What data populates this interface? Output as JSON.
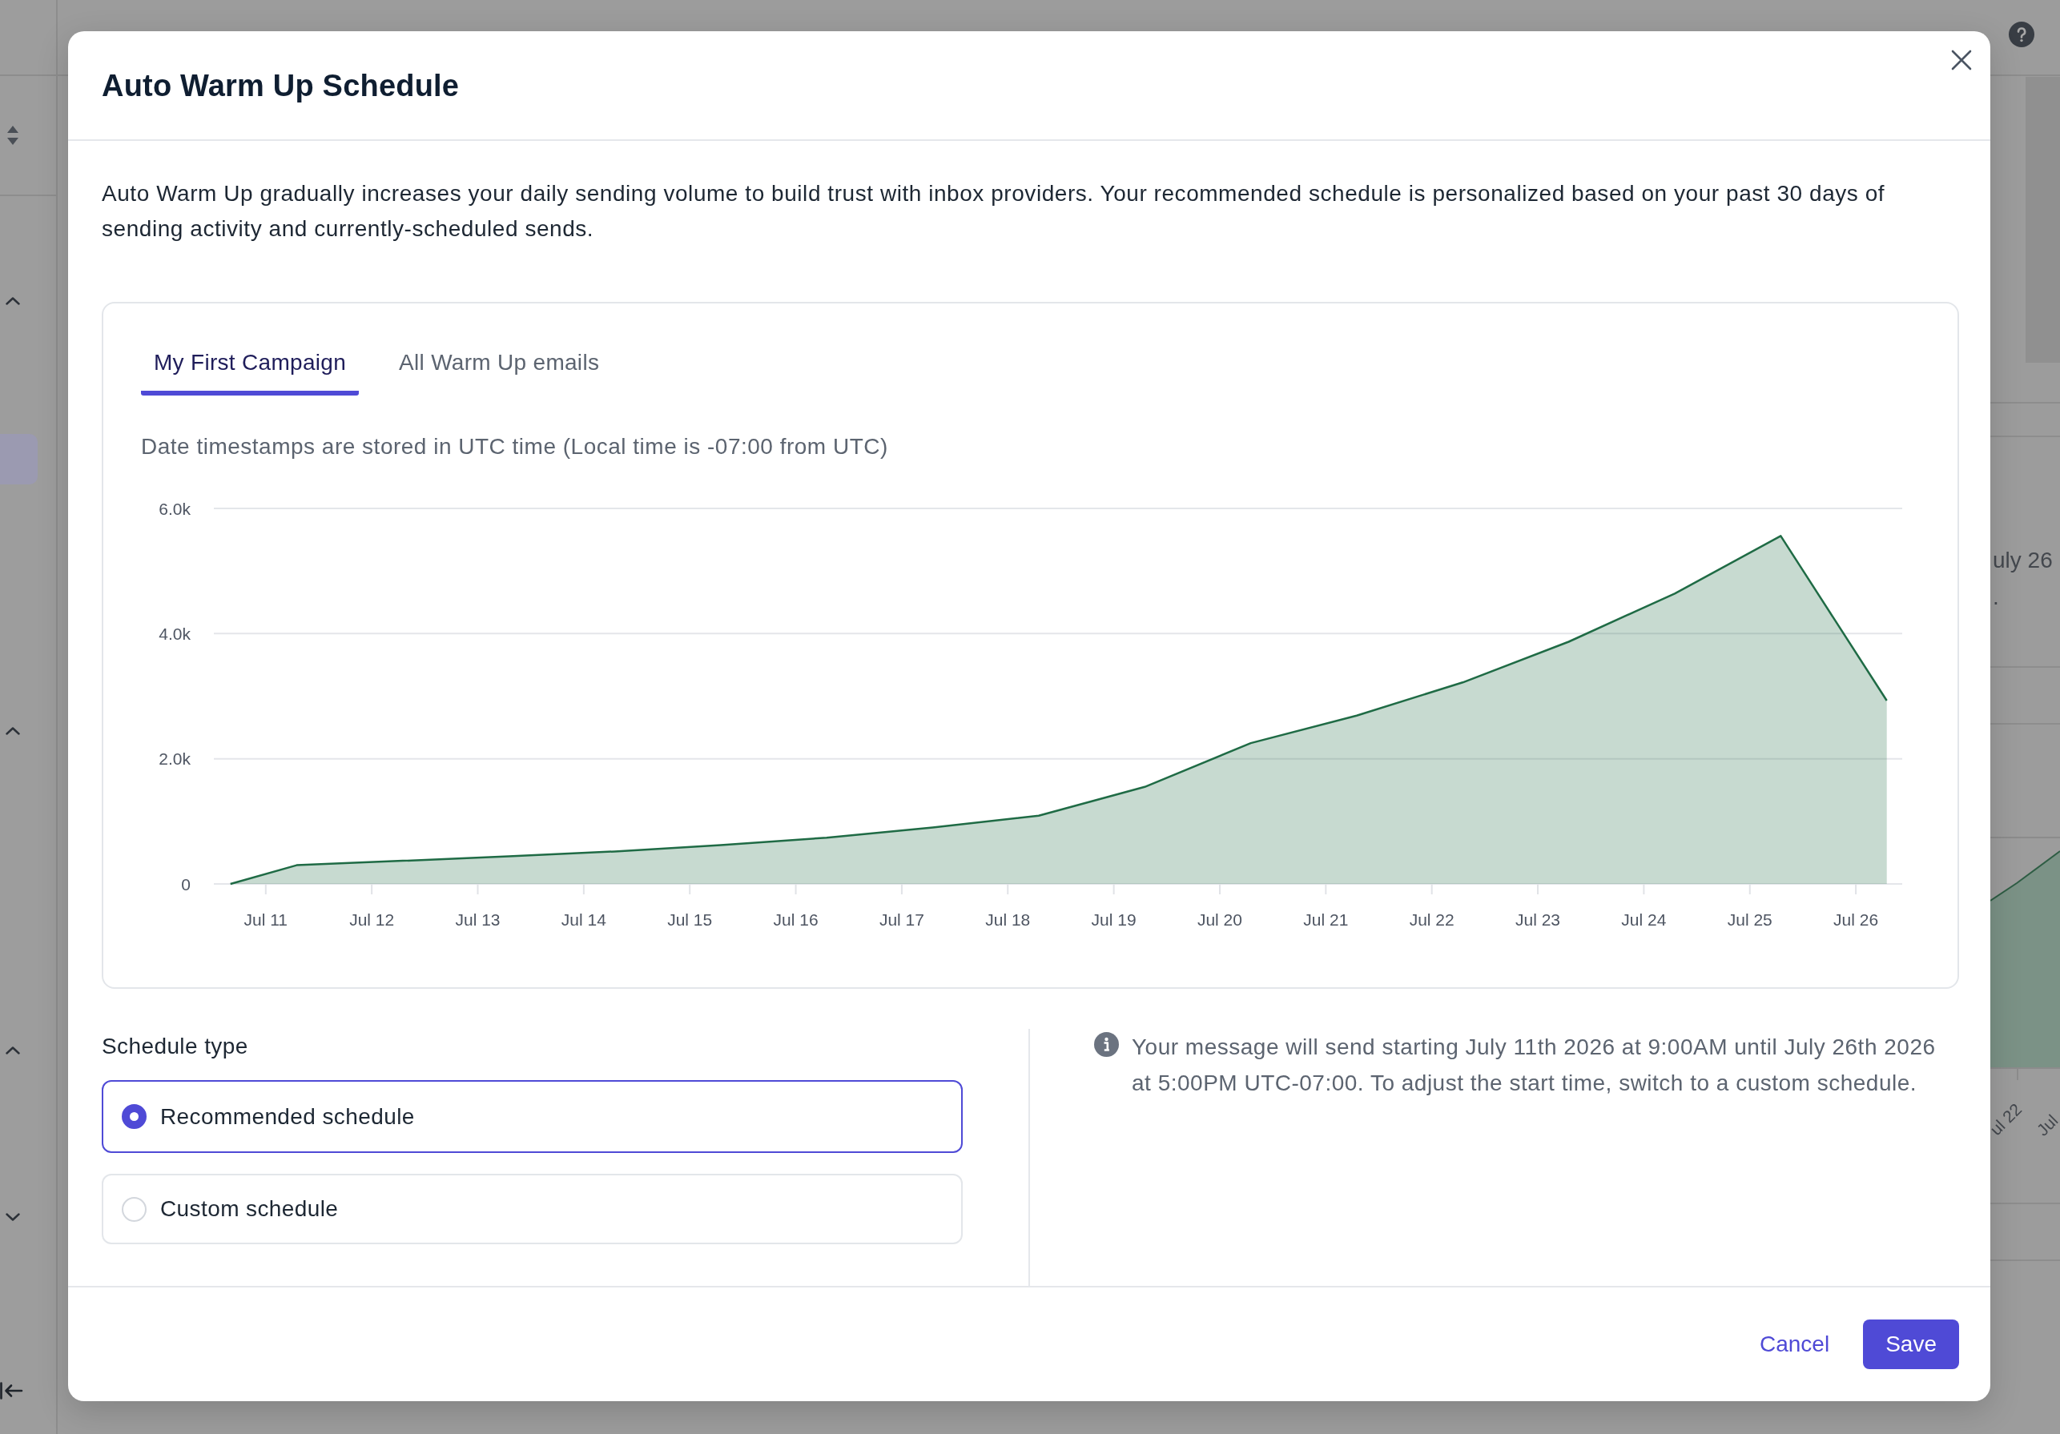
{
  "background": {
    "texts": [
      "uly 26",
      "."
    ],
    "axis_labels": [
      "ul 22",
      "Jul"
    ]
  },
  "dialog": {
    "title": "Auto Warm Up Schedule",
    "description": "Auto Warm Up gradually increases your daily sending volume to build trust with inbox providers. Your recommended schedule is personalized based on your past 30 days of sending activity and currently-scheduled sends.",
    "tabs": [
      {
        "label": "My First Campaign",
        "selected": true
      },
      {
        "label": "All Warm Up emails",
        "selected": false
      }
    ],
    "timezone_note": "Date timestamps are stored in UTC time (Local time is -07:00 from UTC)",
    "chart_data": [
      {
        "type": "area",
        "x": [
          "2026-07-10T16:00",
          "2026-07-11T07:00",
          "2026-07-12T07:00",
          "2026-07-13T07:00",
          "2026-07-14T07:00",
          "2026-07-15T07:00",
          "2026-07-16T07:00",
          "2026-07-17T07:00",
          "2026-07-18T07:00",
          "2026-07-19T07:00",
          "2026-07-20T07:00",
          "2026-07-21T07:00",
          "2026-07-22T07:00",
          "2026-07-23T07:00",
          "2026-07-24T07:00",
          "2026-07-25T07:00",
          "2026-07-26T07:00"
        ],
        "values": [
          0,
          300,
          370,
          440,
          520,
          620,
          740,
          900,
          1090,
          1550,
          2250,
          2690,
          3220,
          3870,
          4640,
          5560,
          2930
        ],
        "color": "#1f6b45",
        "xlim": [
          "2026-07-10T12:15",
          "2026-07-26T10:30"
        ],
        "ylim": [
          0,
          6000
        ],
        "xticks": [
          {
            "value": "2026-07-11",
            "label": "Jul 11"
          },
          {
            "value": "2026-07-12",
            "label": "Jul 12"
          },
          {
            "value": "2026-07-13",
            "label": "Jul 13"
          },
          {
            "value": "2026-07-14",
            "label": "Jul 14"
          },
          {
            "value": "2026-07-15",
            "label": "Jul 15"
          },
          {
            "value": "2026-07-16",
            "label": "Jul 16"
          },
          {
            "value": "2026-07-17",
            "label": "Jul 17"
          },
          {
            "value": "2026-07-18",
            "label": "Jul 18"
          },
          {
            "value": "2026-07-19",
            "label": "Jul 19"
          },
          {
            "value": "2026-07-20",
            "label": "Jul 20"
          },
          {
            "value": "2026-07-21",
            "label": "Jul 21"
          },
          {
            "value": "2026-07-22",
            "label": "Jul 22"
          },
          {
            "value": "2026-07-23",
            "label": "Jul 23"
          },
          {
            "value": "2026-07-24",
            "label": "Jul 24"
          },
          {
            "value": "2026-07-25",
            "label": "Jul 25"
          },
          {
            "value": "2026-07-26",
            "label": "Jul 26"
          }
        ],
        "yticks": [
          {
            "value": 0,
            "label": "0"
          },
          {
            "value": 2000,
            "label": "2.0k"
          },
          {
            "value": 4000,
            "label": "4.0k"
          },
          {
            "value": 6000,
            "label": "6.0k"
          }
        ],
        "grid": "y"
      }
    ],
    "schedule_type": {
      "label": "Schedule type",
      "options": [
        {
          "label": "Recommended schedule",
          "selected": true
        },
        {
          "label": "Custom schedule",
          "selected": false
        }
      ]
    },
    "info": "Your message will send starting July 11th 2026 at 9:00AM until July 26th 2026 at 5:00PM UTC-07:00. To adjust the start time, switch to a custom schedule.",
    "buttons": [
      {
        "label": "Cancel",
        "kind": "link"
      },
      {
        "label": "Save",
        "kind": "primary"
      }
    ]
  }
}
